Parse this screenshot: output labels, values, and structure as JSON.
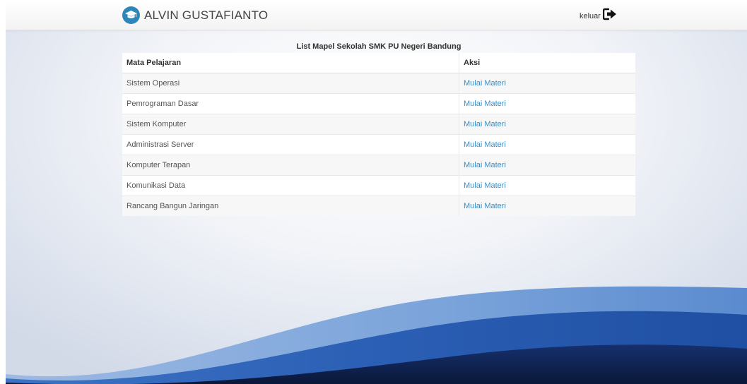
{
  "header": {
    "brand_name": "ALVIN GUSTAFIANTO",
    "brand_icon": "graduation-cap-icon",
    "logout_label": "keluar",
    "logout_icon": "sign-out-icon"
  },
  "main": {
    "caption": "List Mapel Sekolah SMK PU Negeri Bandung",
    "columns": [
      "Mata Pelajaran",
      "Aksi"
    ],
    "rows": [
      {
        "subject": "Sistem Operasi",
        "action": "Mulai Materi"
      },
      {
        "subject": "Pemrograman Dasar",
        "action": "Mulai Materi"
      },
      {
        "subject": "Sistem Komputer",
        "action": "Mulai Materi"
      },
      {
        "subject": "Administrasi Server",
        "action": "Mulai Materi"
      },
      {
        "subject": "Komputer Terapan",
        "action": "Mulai Materi"
      },
      {
        "subject": "Komunikasi Data",
        "action": "Mulai Materi"
      },
      {
        "subject": "Rancang Bangun Jaringan",
        "action": "Mulai Materi"
      }
    ]
  },
  "colors": {
    "link": "#3a8fc8",
    "brand_icon_bg": "#2e85b8",
    "wave_light": "#6d9ad6",
    "wave_mid": "#2b5fb5",
    "wave_dark": "#0f1f4d"
  }
}
